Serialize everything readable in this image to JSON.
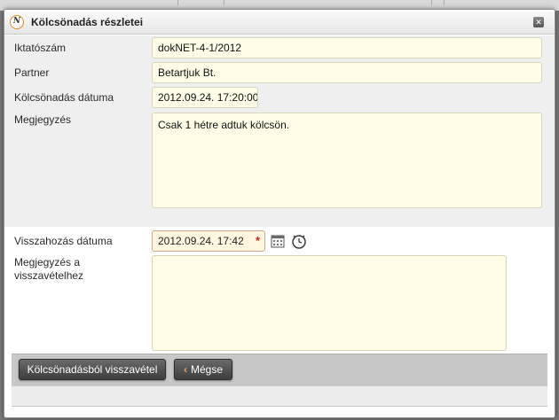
{
  "dialog": {
    "title": "Kölcsönadás részletei",
    "logo_letter": "N",
    "close_glyph": "✕"
  },
  "form": {
    "fields": [
      {
        "label": "Iktatószám",
        "value": "dokNET-4-1/2012"
      },
      {
        "label": "Partner",
        "value": "Betartjuk Bt."
      },
      {
        "label": "Kölcsönadás dátuma",
        "value": "2012.09.24. 17:20:00"
      },
      {
        "label": "Megjegyzés",
        "value": "Csak 1 hétre adtuk kölcsön."
      }
    ],
    "return_date": {
      "label": "Visszahozás dátuma",
      "value": "2012.09.24. 17:42",
      "required_mark": "*"
    },
    "return_note": {
      "label": "Megjegyzés a visszavételhez",
      "value": ""
    }
  },
  "icons": {
    "calendar": "calendar-icon",
    "clock": "clock-icon",
    "close": "close-icon",
    "logo": "doknet-logo-icon"
  },
  "footer": {
    "return_button": "Kölcsönadásból visszavétel",
    "cancel_chevron": "‹",
    "cancel_button": "Mégse"
  },
  "colors": {
    "field_bg": "#fffde8",
    "required_field_bg": "#fff6e0",
    "required_star": "#c0271a",
    "button_bg": "#4d4d4d",
    "accent_orange": "#e08a1a"
  }
}
